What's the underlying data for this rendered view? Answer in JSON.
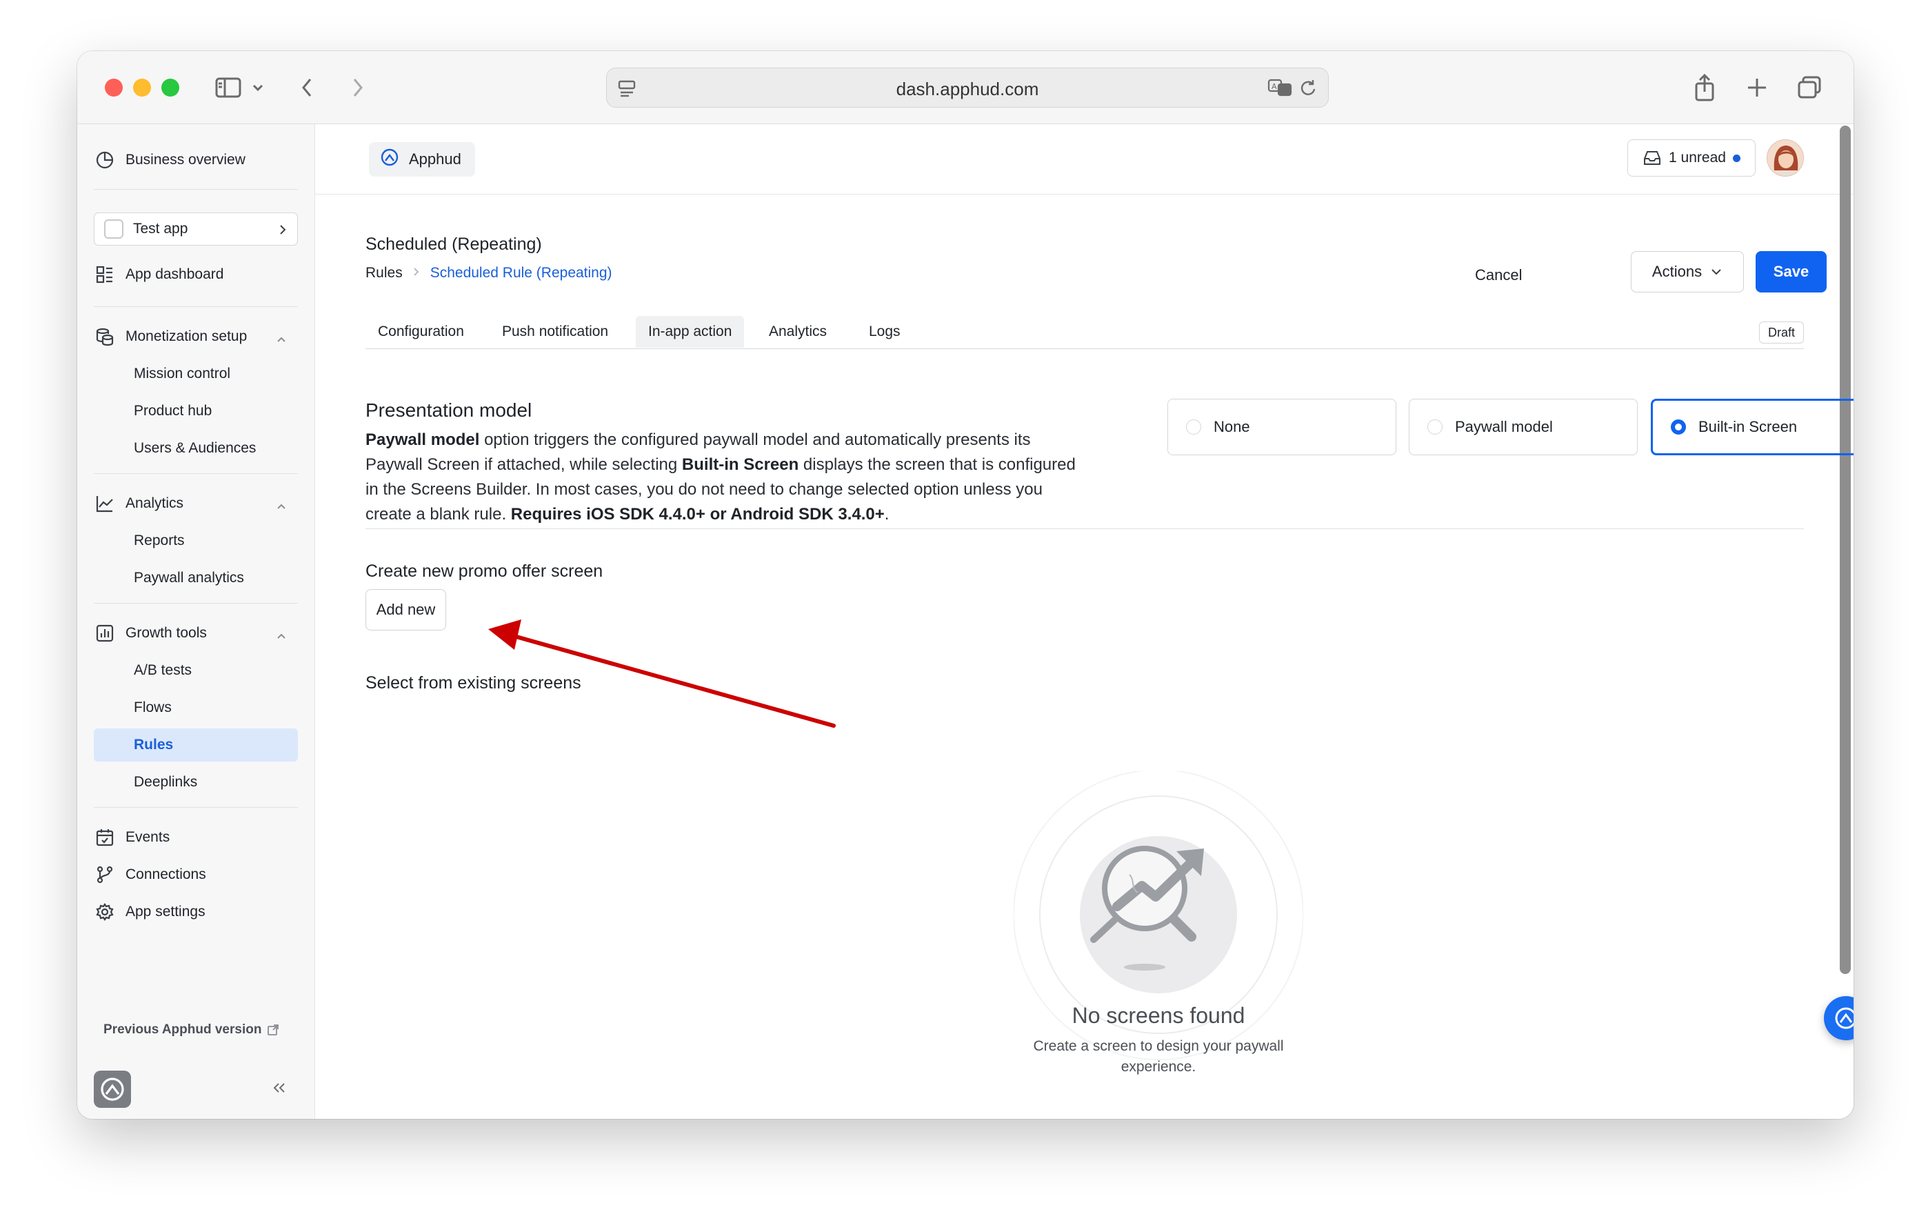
{
  "browser": {
    "url": "dash.apphud.com"
  },
  "sidebar": {
    "business_overview": "Business overview",
    "app_select": "Test app",
    "app_dashboard": "App dashboard",
    "monetization": {
      "label": "Monetization setup",
      "items": [
        "Mission control",
        "Product hub",
        "Users & Audiences"
      ]
    },
    "analytics": {
      "label": "Analytics",
      "items": [
        "Reports",
        "Paywall analytics"
      ]
    },
    "growth": {
      "label": "Growth tools",
      "items": [
        "A/B tests",
        "Flows",
        "Rules",
        "Deeplinks"
      ],
      "active": "Rules"
    },
    "events": "Events",
    "connections": "Connections",
    "app_settings": "App settings",
    "previous_version": "Previous Apphud version"
  },
  "topbar": {
    "org": "Apphud",
    "unread": "1 unread"
  },
  "breadcrumb": {
    "root": "Rules",
    "current": "Scheduled Rule (Repeating)"
  },
  "page": {
    "title": "Scheduled (Repeating)",
    "cancel": "Cancel",
    "actions": "Actions",
    "save": "Save"
  },
  "tabs": {
    "items": [
      "Configuration",
      "Push notification",
      "In-app action",
      "Analytics",
      "Logs"
    ],
    "active": "In-app action",
    "status_badge": "Draft"
  },
  "presentation": {
    "title": "Presentation model",
    "desc_p1_bold": "Paywall model",
    "desc_p2": " option triggers the configured paywall model and automatically presents its Paywall Screen if attached, while selecting ",
    "desc_p3_bold": "Built-in Screen",
    "desc_p4": " displays the screen that is configured in the Screens Builder. In most cases, you do not need to change selected option unless you create a blank rule. ",
    "desc_p5_bold": "Requires iOS SDK 4.4.0+ or Android SDK 3.4.0+",
    "desc_p6": ".",
    "options": [
      "None",
      "Paywall model",
      "Built-in Screen"
    ],
    "selected": "Built-in Screen"
  },
  "promo": {
    "create_title": "Create new promo offer screen",
    "add_new": "Add new",
    "select_title": "Select from existing screens"
  },
  "empty_state": {
    "title": "No screens found",
    "desc": "Create a screen to design your paywall experience."
  },
  "colors": {
    "accent": "#1063f0",
    "active_nav_bg": "#dbe8fc",
    "annotation_arrow": "#cc0000"
  }
}
